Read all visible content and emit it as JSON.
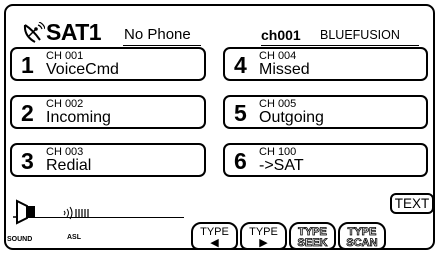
{
  "header": {
    "title": "SAT1",
    "phone_status": "No Phone",
    "channel_number": "ch001",
    "channel_name": "BLUEFUSION"
  },
  "presets": [
    {
      "number": "1",
      "channel": "CH 001",
      "label": "VoiceCmd"
    },
    {
      "number": "2",
      "channel": "CH 002",
      "label": "Incoming"
    },
    {
      "number": "3",
      "channel": "CH 003",
      "label": "Redial"
    },
    {
      "number": "4",
      "channel": "CH 004",
      "label": "Missed"
    },
    {
      "number": "5",
      "channel": "CH 005",
      "label": "Outgoing"
    },
    {
      "number": "6",
      "channel": "CH 100",
      "label": "->SAT"
    }
  ],
  "controls": {
    "text_label": "TEXT",
    "type_prev": {
      "label": "TYPE",
      "symbol": "◀"
    },
    "type_next": {
      "label": "TYPE",
      "symbol": "▶"
    },
    "type_seek": {
      "label": "TYPE",
      "sub": "SEEK"
    },
    "type_scan": {
      "label": "TYPE",
      "sub": "SCAN"
    }
  },
  "footer": {
    "sound_label": "SOUND",
    "asl_label": "ASL"
  },
  "icons": {
    "satellite": "satellite-dish-icon",
    "speaker": "speaker-icon",
    "asl": "sound-wave-icon"
  },
  "colors": {
    "foreground": "#000000",
    "background": "#ffffff"
  }
}
